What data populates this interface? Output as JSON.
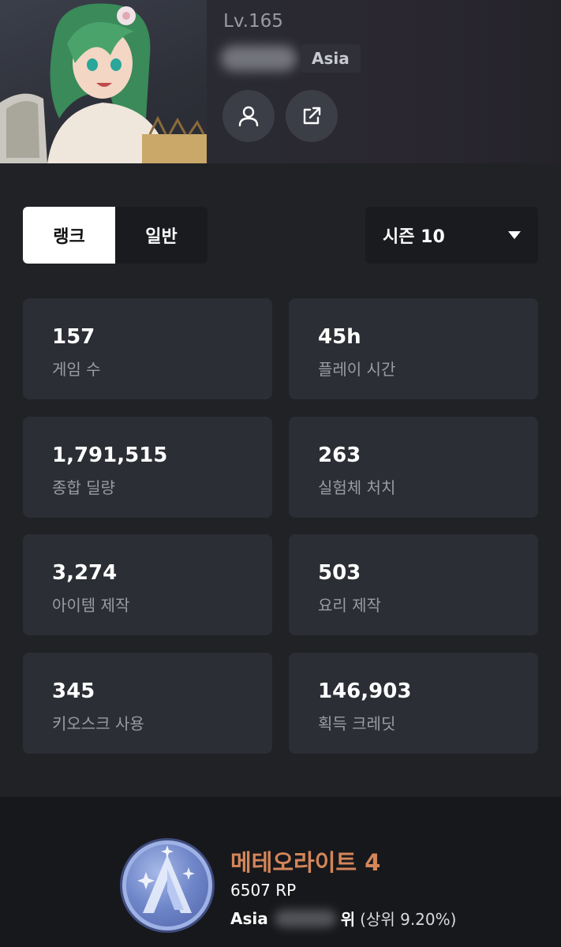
{
  "profile": {
    "level": "Lv.165",
    "region": "Asia"
  },
  "icons": {
    "profile": "person-icon",
    "share": "external-link-icon",
    "dropdown": "caret-down-icon"
  },
  "tabs": [
    {
      "label": "랭크",
      "active": true
    },
    {
      "label": "일반",
      "active": false
    }
  ],
  "season": {
    "selected": "시즌 10"
  },
  "stats": [
    {
      "value": "157",
      "label": "게임 수"
    },
    {
      "value": "45h",
      "label": "플레이 시간"
    },
    {
      "value": "1,791,515",
      "label": "종합 딜량"
    },
    {
      "value": "263",
      "label": "실험체 처치"
    },
    {
      "value": "3,274",
      "label": "아이템 제작"
    },
    {
      "value": "503",
      "label": "요리 제작"
    },
    {
      "value": "345",
      "label": "키오스크 사용"
    },
    {
      "value": "146,903",
      "label": "획득 크레딧"
    }
  ],
  "rank": {
    "tier": "메테오라이트 4",
    "rp": "6507 RP",
    "region": "Asia",
    "rank_suffix": "위",
    "percent": "(상위 9.20%)",
    "tier_color": "#d4865a"
  }
}
